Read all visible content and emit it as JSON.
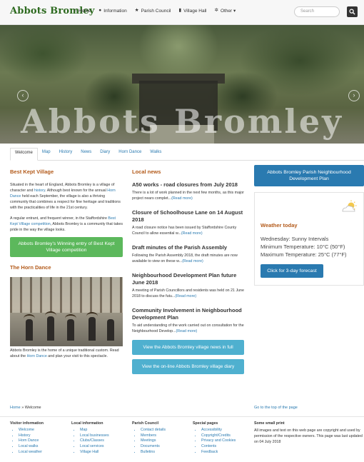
{
  "nav": {
    "brand": "Abbots Bromley",
    "items": [
      {
        "label": "Home",
        "icon": "home-icon",
        "glyph": "⌂"
      },
      {
        "label": "Information",
        "icon": "info-icon",
        "glyph": "●"
      },
      {
        "label": "Parish Council",
        "icon": "star-icon",
        "glyph": "★"
      },
      {
        "label": "Village Hall",
        "icon": "bookmark-icon",
        "glyph": "▮"
      },
      {
        "label": "Other ▾",
        "icon": "gear-icon",
        "glyph": "✲"
      }
    ],
    "search_placeholder": "Search"
  },
  "hero": {
    "title": "Abbots Bromley",
    "prev": "‹",
    "next": "›"
  },
  "tabs": [
    "Welcome",
    "Map",
    "History",
    "News",
    "Diary",
    "Horn Dance",
    "Walks"
  ],
  "left": {
    "heading": "Best Kept Village",
    "p1_a": "Situated in the heart of England, Abbots Bromley is a village of character and ",
    "p1_link1": "history",
    "p1_b": ". Although best known for the annual ",
    "p1_link2": "Horn Dance",
    "p1_c": " held each September, the village is also a thriving community that combines a respect for fine heritage and traditions with the practicalities of life in the 21st century.",
    "p2_a": "A regular entrant, and frequent winner, in the Staffordshire ",
    "p2_link": "Best Kept Village competition",
    "p2_b": ", Abbots Bromley is a community that takes pride in the way the village looks.",
    "button": "Abbots Bromley's Winning entry of Best Kept Village competition",
    "heading2": "The Horn Dance",
    "p3_a": "Abbots Bromley is the home of a unique traditional custom. Read about the ",
    "p3_link": "Horn Dance",
    "p3_b": " and plan your visit to this spectacle."
  },
  "mid": {
    "heading": "Local news",
    "news": [
      {
        "title": "A50 works - road closures from July 2018",
        "text": "There is a lot of work planned in the next few months, as this major project nears complet...",
        "more": "(Read more)"
      },
      {
        "title": "Closure of Schoolhouse Lane on 14 August 2018",
        "text": "A road closure notice has been issued by Staffordshire County Council to allow essential w...",
        "more": "(Read more)"
      },
      {
        "title": "Draft minutes of the Parish Assembly",
        "text": "Following the Parish Assembly 2018, the draft minutes are now available to view on these w...",
        "more": "(Read more)"
      },
      {
        "title": "Neighbourhood Development Plan future June 2018",
        "text": "A meeting of Parish Councillors and residents was held on 21 June 2018 to discuss the futu...",
        "more": "(Read more)"
      },
      {
        "title": "Community Involvement in Neighbourhood Development Plan",
        "text": "To aid understanding of the work carried out on consultation for the Neighbourhood Develop...",
        "more": "(Read more)"
      }
    ],
    "btn_news": "View the Abbots Bromley village news in full",
    "btn_diary": "View the on-line Abbots Bromley village diary"
  },
  "right": {
    "plan_button": "Abbots Bromley Parish Neighbourhood Development Plan",
    "weather_heading": "Weather today",
    "weather_icon": "partly-cloudy-icon",
    "lines": [
      "Wednesday: Sunny Intervals",
      "Minimum Temperature: 10°C (50°F)",
      "Maximum Temperature: 25°C (77°F)"
    ],
    "forecast_button": "Click for 3-day forecast"
  },
  "breadcrumb": {
    "home": "Home",
    "sep": " » ",
    "current": "Welcome"
  },
  "top_link": "Go to the top of the page",
  "footer": {
    "visitor": {
      "heading": "Visitor information",
      "items": [
        "Welcome",
        "History",
        "Horn Dance",
        "Local walks",
        "Local weather"
      ]
    },
    "local": {
      "heading": "Local information",
      "items": [
        "Map",
        "Local businesses",
        "Clubs/Classes",
        "Local services",
        "Village Hall"
      ]
    },
    "parish": {
      "heading": "Parish Council",
      "items": [
        "Contact details",
        "Members",
        "Meetings",
        "Documents",
        "Bulletins"
      ]
    },
    "special": {
      "heading": "Special pages",
      "items": [
        "Accessibility",
        "Copyright/Credits",
        "Privacy and Cookies",
        "Contents",
        "Feedback"
      ]
    },
    "print": {
      "heading": "Some small print",
      "text": "All images and text on this web page are copyright and used by permission of the respective owners. This page was last updated on 04 July 2018"
    }
  },
  "colors": {
    "brand": "#2d6a1f",
    "heading": "#b35a1a",
    "link": "#2a7ab0",
    "green": "#5cb85c",
    "teal": "#4fb0cf"
  }
}
